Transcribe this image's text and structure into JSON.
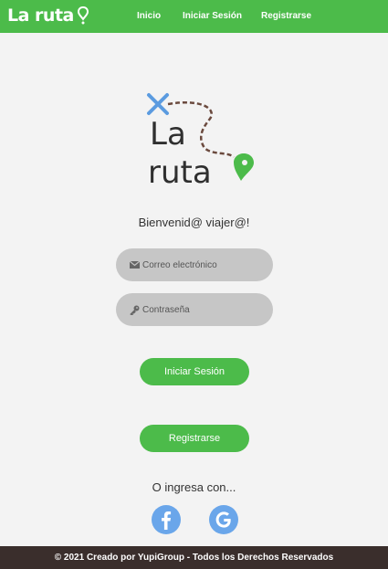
{
  "navbar": {
    "brand": "La ruta",
    "links": [
      "Inicio",
      "Iniciar Sesión",
      "Registrarse"
    ]
  },
  "logo": {
    "line1": "La",
    "line2": "ruta"
  },
  "welcome": "Bienvenid@ viajer@!",
  "form": {
    "email_placeholder": "Correo electrónico",
    "password_placeholder": "Contraseña",
    "login_button": "Iniciar Sesión",
    "register_button": "Registrarse"
  },
  "social": {
    "heading": "O ingresa con...",
    "providers": [
      "facebook-icon",
      "google-icon"
    ]
  },
  "footer": "© 2021 Creado por YupiGroup - Todos los Derechos Reservados",
  "colors": {
    "brand_green": "#4cbb4a",
    "field_gray": "#c6c6c6",
    "social_blue": "#6aa6ea",
    "footer_brown": "#3a2e2c"
  }
}
